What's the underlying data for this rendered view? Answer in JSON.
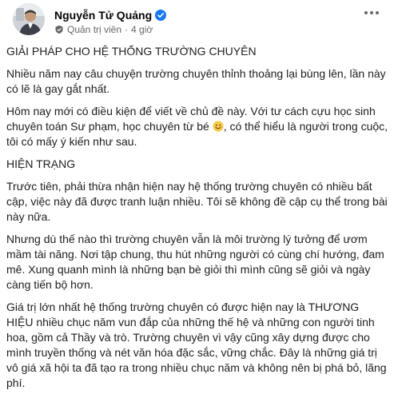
{
  "author": {
    "name": "Nguyễn Tử Quảng",
    "role": "Quản trị viên",
    "time": "4 giờ",
    "separator": "·",
    "verified_icon": "verified-badge-icon",
    "role_icon": "admin-shield-icon"
  },
  "colors": {
    "verified": "#1877f2",
    "meta_text": "#65676b",
    "text": "#1c1e21"
  },
  "post": {
    "title": "GIẢI PHÁP CHO HỆ THỐNG TRƯỜNG CHUYÊN",
    "p1": "Nhiều năm nay câu chuyện trường chuyên thỉnh thoảng lại bùng lên, lần này có lẽ là gay gắt nhất.",
    "p2_before_emoji": "Hôm nay mới có điều kiện để viết về chủ đề này. Với tư cách cựu học sinh chuyên toán Sư phạm, học chuyên từ bé ",
    "p2_after_emoji": ", có thể hiểu là người trong cuộc, tôi có mấy ý kiến như sau.",
    "emoji": "smiling-face-icon",
    "section_heading": "HIỆN TRẠNG",
    "p3": "Trước tiên, phải thừa nhận hiện nay hệ thống trường chuyên có nhiều bất cập, việc này đã được tranh luận nhiều. Tôi sẽ không đề cập cụ thể trong bài này nữa.",
    "p4": "Nhưng dù thế nào thì trường chuyên vẫn là môi trường lý tưởng để ươm mầm tài năng. Nơi tập chung, thu hút những người có cùng chí hướng, đam mê. Xung quanh mình là những bạn bè giỏi thì mình cũng sẽ giỏi và ngày càng tiến bộ hơn.",
    "p5": "Giá trị lớn nhất hệ thống trường chuyên có được hiện nay là THƯƠNG HIỆU nhiều chục năm vun đắp của những thế hệ và những con người tinh hoa, gồm cả Thầy và trò. Trường chuyên vì vậy cũng xây dựng được cho mình truyền thống và nét văn hóa đặc sắc, vững chắc. Đây là những giá trị vô giá xã hội ta đã tạo ra trong nhiều chục năm và không nên bị phá bỏ, lãng phí."
  },
  "controls": {
    "more_icon": "more-options-icon"
  }
}
